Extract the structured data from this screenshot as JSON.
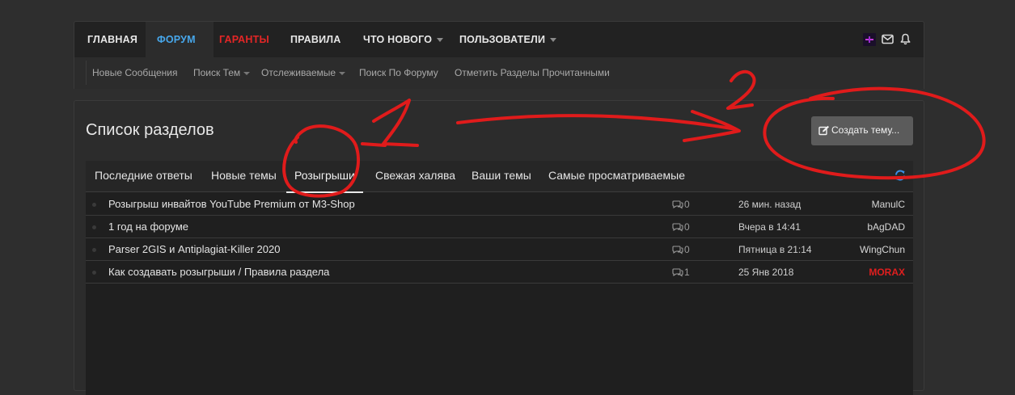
{
  "nav": {
    "items": [
      {
        "label": "ГЛАВНАЯ"
      },
      {
        "label": "ФОРУМ"
      },
      {
        "label": "ГАРАНТЫ"
      },
      {
        "label": "ПРАВИЛА"
      },
      {
        "label": "ЧТО НОВОГО"
      },
      {
        "label": "ПОЛЬЗОВАТЕЛИ"
      }
    ]
  },
  "subnav": {
    "items": [
      {
        "label": "Новые Сообщения"
      },
      {
        "label": "Поиск Тем"
      },
      {
        "label": "Отслеживаемые"
      },
      {
        "label": "Поиск По Форуму"
      },
      {
        "label": "Отметить Разделы Прочитанными"
      }
    ]
  },
  "page": {
    "title": "Список разделов",
    "create_button": "Создать тему..."
  },
  "tabs": [
    {
      "label": "Последние ответы"
    },
    {
      "label": "Новые темы"
    },
    {
      "label": "Розыгрыши"
    },
    {
      "label": "Свежая халява"
    },
    {
      "label": "Ваши темы"
    },
    {
      "label": "Самые просматриваемые"
    }
  ],
  "threads": [
    {
      "title": "Розыгрыш инвайтов YouTube Premium от M3-Shop",
      "replies": "0",
      "date": "26 мин. назад",
      "user": "ManulC"
    },
    {
      "title": "1 год на форуме",
      "replies": "0",
      "date": "Вчера в 14:41",
      "user": "bAgDAD"
    },
    {
      "title": "Parser 2GIS и Antiplagiat-Killer 2020",
      "replies": "0",
      "date": "Пятница в 21:14",
      "user": "WingChun"
    },
    {
      "title": "Как создавать розыгрыши / Правила раздела",
      "replies": "1",
      "date": "25 Янв 2018",
      "user": "MORAX"
    }
  ],
  "annotations": {
    "mark_1": "1",
    "mark_2": "2"
  },
  "colors": {
    "accent": "#47a7eb",
    "red": "#e32626",
    "annotation": "#e01b1b"
  },
  "icons": [
    "avatar",
    "envelope-icon",
    "bell-icon",
    "pencil-icon",
    "refresh-icon",
    "comments-icon"
  ]
}
